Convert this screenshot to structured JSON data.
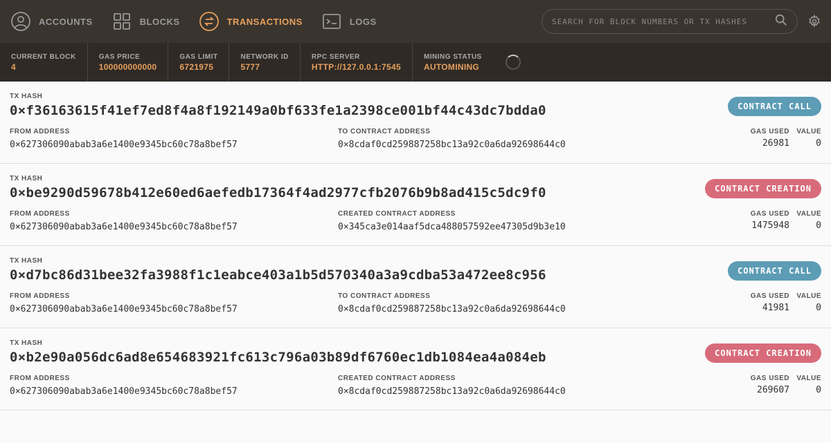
{
  "nav": {
    "accounts": "ACCOUNTS",
    "blocks": "BLOCKS",
    "transactions": "TRANSACTIONS",
    "logs": "LOGS"
  },
  "search": {
    "placeholder": "SEARCH FOR BLOCK NUMBERS OR TX HASHES"
  },
  "status": {
    "current_block_label": "CURRENT BLOCK",
    "current_block": "4",
    "gas_price_label": "GAS PRICE",
    "gas_price": "100000000000",
    "gas_limit_label": "GAS LIMIT",
    "gas_limit": "6721975",
    "network_id_label": "NETWORK ID",
    "network_id": "5777",
    "rpc_server_label": "RPC SERVER",
    "rpc_server": "HTTP://127.0.0.1:7545",
    "mining_status_label": "MINING STATUS",
    "mining_status": "AUTOMINING"
  },
  "labels": {
    "tx_hash": "TX HASH",
    "from_address": "FROM ADDRESS",
    "to_contract_address": "TO CONTRACT ADDRESS",
    "created_contract_address": "CREATED CONTRACT ADDRESS",
    "gas_used": "GAS USED",
    "value": "VALUE",
    "contract_call": "CONTRACT CALL",
    "contract_creation": "CONTRACT CREATION"
  },
  "transactions": [
    {
      "hash": "0×f36163615f41ef7ed8f4a8f192149a0bf633fe1a2398ce001bf44c43dc7bdda0",
      "type": "call",
      "from": "0×627306090abab3a6e1400e9345bc60c78a8bef57",
      "to": "0×8cdaf0cd259887258bc13a92c0a6da92698644c0",
      "gas_used": "26981",
      "value": "0"
    },
    {
      "hash": "0×be9290d59678b412e60ed6aefedb17364f4ad2977cfb2076b9b8ad415c5dc9f0",
      "type": "creation",
      "from": "0×627306090abab3a6e1400e9345bc60c78a8bef57",
      "to": "0×345ca3e014aaf5dca488057592ee47305d9b3e10",
      "gas_used": "1475948",
      "value": "0"
    },
    {
      "hash": "0×d7bc86d31bee32fa3988f1c1eabce403a1b5d570340a3a9cdba53a472ee8c956",
      "type": "call",
      "from": "0×627306090abab3a6e1400e9345bc60c78a8bef57",
      "to": "0×8cdaf0cd259887258bc13a92c0a6da92698644c0",
      "gas_used": "41981",
      "value": "0"
    },
    {
      "hash": "0×b2e90a056dc6ad8e654683921fc613c796a03b89df6760ec1db1084ea4a084eb",
      "type": "creation",
      "from": "0×627306090abab3a6e1400e9345bc60c78a8bef57",
      "to": "0×8cdaf0cd259887258bc13a92c0a6da92698644c0",
      "gas_used": "269607",
      "value": "0"
    }
  ]
}
